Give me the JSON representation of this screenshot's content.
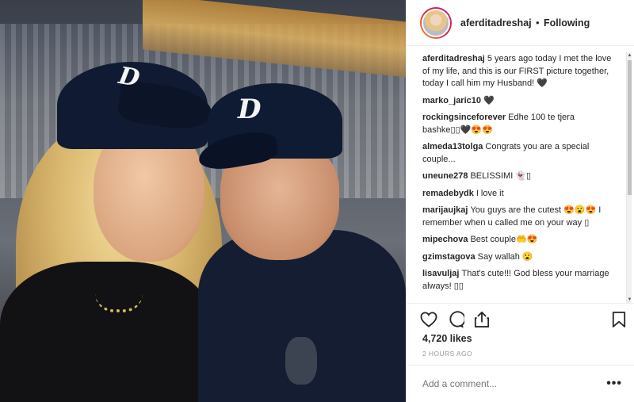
{
  "post": {
    "author": "aferditadreshaj",
    "separator": "•",
    "follow_status": "Following",
    "caption_user": "aferditadreshaj",
    "caption_text": "5 years ago today I met the love of my life, and this is our FIRST picture together, today I call him my Husband! 🖤",
    "comments": [
      {
        "user": "marko_jaric10",
        "text": "🖤"
      },
      {
        "user": "rockingsinceforever",
        "text": "Edhe 100 te tjera bashke▯▯🖤😍😍"
      },
      {
        "user": "almeda13tolga",
        "text": "Congrats you are a special couple..."
      },
      {
        "user": "uneune278",
        "text": "BELISSIMI 👻▯"
      },
      {
        "user": "remadebydk",
        "text": "I love it"
      },
      {
        "user": "marijaujkaj",
        "text": "You guys are the cutest 😍😮😍 I remember when u called me on your way ▯"
      },
      {
        "user": "mipechova",
        "text": "Best couple🤲😍"
      },
      {
        "user": "gzimstagova",
        "text": "Say wallah 😮"
      },
      {
        "user": "lisavuljaj",
        "text": "That's cute!!! God bless your marriage always! ▯▯"
      }
    ],
    "likes": "4,720 likes",
    "timestamp": "2 HOURS AGO",
    "add_comment_placeholder": "Add a comment...",
    "more_label": "•••",
    "photo_logo_letter": "D"
  },
  "icons": {
    "like": "heart-icon",
    "comment": "comment-bubble-icon",
    "share": "share-icon",
    "save": "bookmark-icon"
  },
  "colors": {
    "text": "#262626",
    "muted": "#999999",
    "border": "#efefef",
    "cap_navy": "#101b33"
  }
}
